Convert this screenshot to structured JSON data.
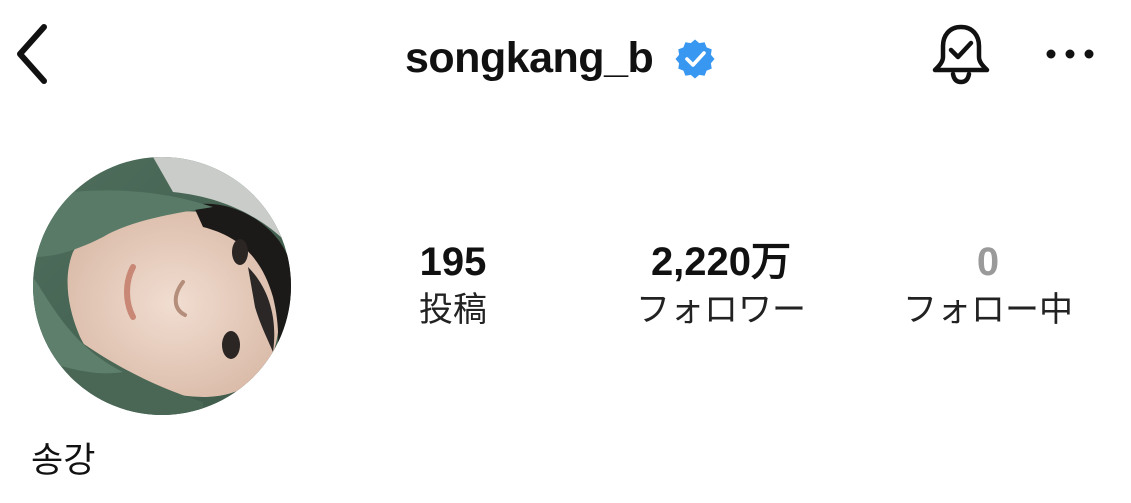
{
  "header": {
    "username": "songkang_b",
    "back_icon": "chevron-left-icon",
    "verified_icon": "verified-badge-icon",
    "notification_icon": "bell-check-icon",
    "more_icon": "more-horizontal-icon",
    "verified_color": "#3897f0"
  },
  "profile": {
    "display_name": "송강",
    "avatar_icon": "profile-photo"
  },
  "stats": {
    "posts": {
      "count": "195",
      "label": "投稿"
    },
    "followers": {
      "count": "2,220万",
      "label": "フォロワー"
    },
    "following": {
      "count": "0",
      "label": "フォロー中"
    }
  }
}
